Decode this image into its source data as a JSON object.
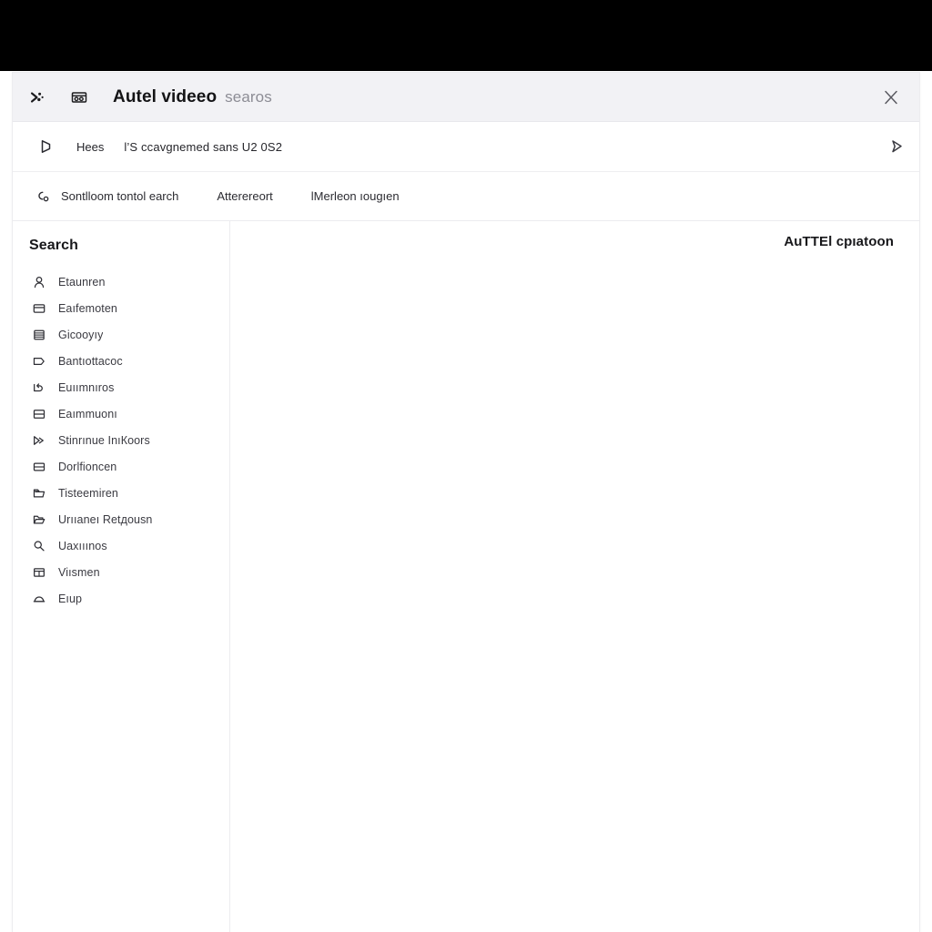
{
  "window": {
    "titlebar": {
      "menu_icon": "scatter-dots-icon",
      "app_icon": "video-frame-icon",
      "title": "Autel videeo",
      "subtitle": "searos",
      "close_icon": "close-icon"
    },
    "pathrow": {
      "lead_icon": "play-outline-icon",
      "label": "Hees",
      "value": "l’S ccavgnemed sans U2 0S2",
      "tail_icon": "send-icon"
    },
    "toolbar": {
      "items": [
        {
          "icon": "link-search-icon",
          "label": "Sontlloom tontol earch"
        },
        {
          "icon": "",
          "label": "Atterereort"
        },
        {
          "icon": "",
          "label": "lMerleon ıouɡıеn"
        }
      ]
    }
  },
  "sidebar": {
    "title": "Search",
    "items": [
      {
        "icon": "user-icon",
        "label": "Etаunren"
      },
      {
        "icon": "card-icon",
        "label": "Eaıfemoten"
      },
      {
        "icon": "list-icon",
        "label": "Gicooyıу"
      },
      {
        "icon": "tag-icon",
        "label": "Bantıottacoс"
      },
      {
        "icon": "reply-icon",
        "label": "Euıımnıroѕ"
      },
      {
        "icon": "window-icon",
        "label": "Eаımmuonı"
      },
      {
        "icon": "play-double-icon",
        "label": "Stinrınue InıКoors"
      },
      {
        "icon": "panel-icon",
        "label": "Dorlfioncen"
      },
      {
        "icon": "folder-icon",
        "label": "Tisteemiren"
      },
      {
        "icon": "folder-open-icon",
        "label": "Urııаneı Retдousn"
      },
      {
        "icon": "search-icon",
        "label": "Uaхııınoѕ"
      },
      {
        "icon": "table-icon",
        "label": "Viısmen"
      },
      {
        "icon": "bell-icon",
        "label": "Eıup"
      }
    ]
  },
  "content": {
    "heading": "AuTTEl cpıatoon"
  }
}
